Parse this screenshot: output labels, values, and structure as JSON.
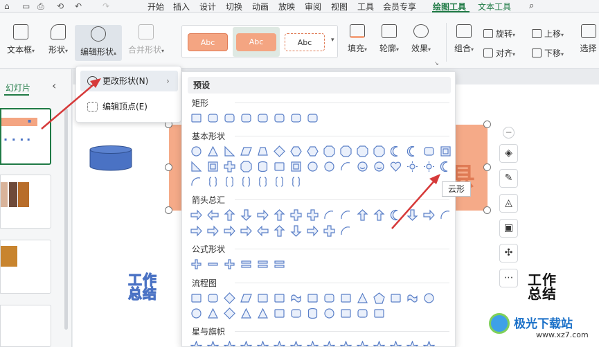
{
  "menubar": {
    "quick": [
      "⌂",
      "▭",
      "⎙",
      "⟲",
      "↶",
      "↷"
    ],
    "tabs": [
      "开始",
      "插入",
      "设计",
      "切换",
      "动画",
      "放映",
      "审阅",
      "视图",
      "工具",
      "会员专享",
      "绘图工具",
      "文本工具"
    ],
    "active_tab": "绘图工具",
    "search_icon": "search-icon"
  },
  "ribbon": {
    "textbox": "文本框",
    "shape": "形状",
    "edit_shape": "编辑形状",
    "merge_shape": "合并形状",
    "styles": [
      "Abc",
      "Abc",
      "Abc"
    ],
    "fill": "填充",
    "outline": "轮廓",
    "effect": "效果",
    "combine": "组合",
    "rotate": "旋转",
    "align": "对齐",
    "up": "上移",
    "down": "下移",
    "select": "选择"
  },
  "leftpanel": {
    "title": "幻灯片",
    "collapse": "‹"
  },
  "contextmenu": {
    "change_shape": "更改形状(N)",
    "edit_points": "编辑顶点(E)"
  },
  "shapes_panel": {
    "header": "预设",
    "categories": [
      "矩形",
      "基本形状",
      "箭头总汇",
      "公式形状",
      "流程图",
      "星与旗帜"
    ]
  },
  "tooltip": "云形",
  "slide": {
    "title_left": "工作总结",
    "title_right": "工作总结",
    "partial_char": "县"
  },
  "watermark": {
    "name": "极光下载站",
    "url": "www.xz7.com"
  },
  "colors": {
    "accent": "#1f7a45",
    "orange": "#f4a582",
    "blue": "#4a72c4",
    "arrow": "#d63a3a"
  }
}
